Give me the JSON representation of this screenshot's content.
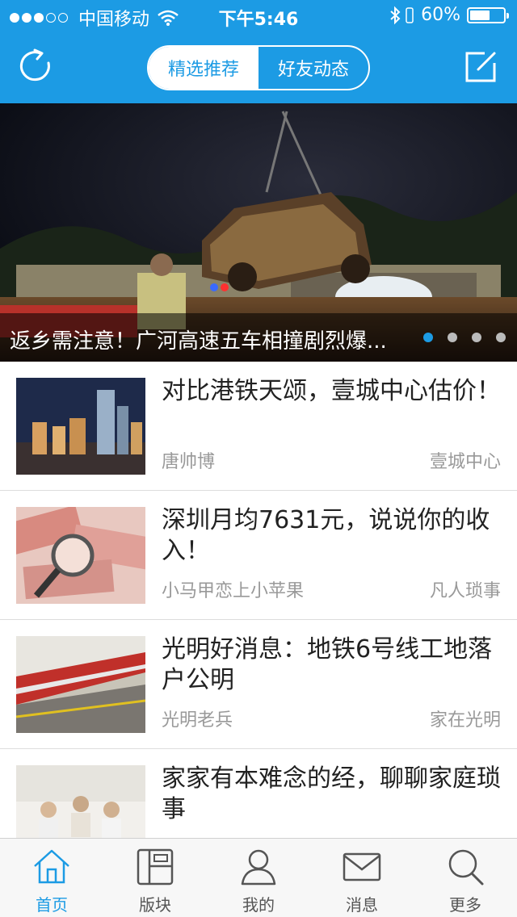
{
  "status_bar": {
    "signal_dots_filled": 3,
    "signal_dots_total": 5,
    "carrier": "中国移动",
    "time": "下午5:46",
    "battery": "60%",
    "battery_level": 0.6
  },
  "header": {
    "tabs": [
      {
        "label": "精选推荐",
        "active": true
      },
      {
        "label": "好友动态",
        "active": false
      }
    ],
    "refresh_icon": "refresh-icon",
    "compose_icon": "compose-icon"
  },
  "banner": {
    "title": "返乡需注意！广河高速五车相撞剧烈爆...",
    "page_count": 4,
    "active_page": 1
  },
  "posts": [
    {
      "title": "对比港铁天颂，壹城中心估价！",
      "author": "唐帅博",
      "forum": "壹城中心"
    },
    {
      "title": "深圳月均7631元，说说你的收入！",
      "author": "小马甲恋上小苹果",
      "forum": "凡人琐事"
    },
    {
      "title": "光明好消息：地铁6号线工地落户公明",
      "author": "光明老兵",
      "forum": "家在光明"
    },
    {
      "title": "家家有本难念的经，聊聊家庭琐事",
      "author": "",
      "forum": ""
    }
  ],
  "tabbar": {
    "items": [
      {
        "label": "首页",
        "icon": "home-icon",
        "active": true
      },
      {
        "label": "版块",
        "icon": "sections-icon",
        "active": false
      },
      {
        "label": "我的",
        "icon": "profile-icon",
        "active": false
      },
      {
        "label": "消息",
        "icon": "mail-icon",
        "active": false
      },
      {
        "label": "更多",
        "icon": "search-icon",
        "active": false
      }
    ]
  },
  "colors": {
    "brand": "#1c9be4",
    "muted_text": "#999999",
    "tabbar_bg": "#f7f7f7"
  }
}
